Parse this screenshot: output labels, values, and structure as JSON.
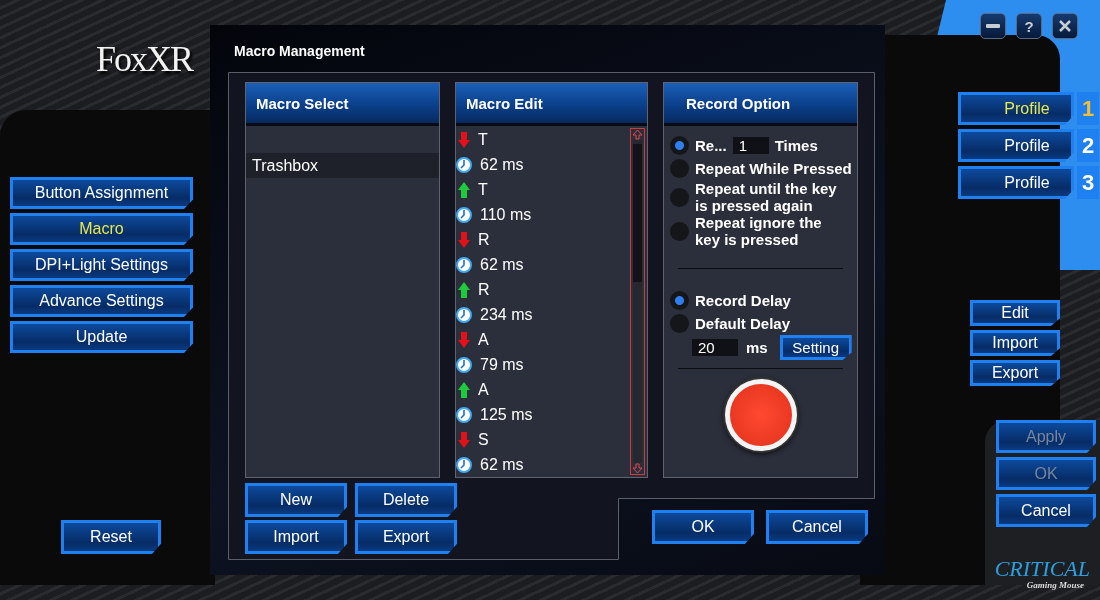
{
  "brand": {
    "logo": "FoxXR"
  },
  "window_controls": [
    {
      "kind": "minimize"
    },
    {
      "kind": "help",
      "label": "?"
    },
    {
      "kind": "close"
    }
  ],
  "sidebar": {
    "items": [
      {
        "label": "Button Assignment",
        "selected": false
      },
      {
        "label": "Macro",
        "selected": true
      },
      {
        "label": "DPI+Light Settings",
        "selected": false
      },
      {
        "label": "Advance Settings",
        "selected": false
      },
      {
        "label": "Update",
        "selected": false
      }
    ],
    "reset": "Reset"
  },
  "profiles": [
    {
      "label": "Profile",
      "number": "1",
      "selected": true
    },
    {
      "label": "Profile",
      "number": "2",
      "selected": false
    },
    {
      "label": "Profile",
      "number": "3",
      "selected": false
    }
  ],
  "profile_actions": [
    "Edit",
    "Import",
    "Export"
  ],
  "main_actions": [
    {
      "label": "Apply",
      "disabled": true
    },
    {
      "label": "OK",
      "disabled": true
    },
    {
      "label": "Cancel",
      "disabled": false
    }
  ],
  "footer_logo": {
    "title": "CRITICAL",
    "subtitle": "Gaming Mouse"
  },
  "dialog": {
    "title": "Macro Management",
    "macro_select": {
      "heading": "Macro Select",
      "items": [
        {
          "label": "Trashbox",
          "selected": true
        }
      ]
    },
    "macro_edit": {
      "heading": "Macro Edit",
      "rows": [
        {
          "kind": "down",
          "text": "T"
        },
        {
          "kind": "delay",
          "text": "62 ms"
        },
        {
          "kind": "up",
          "text": "T"
        },
        {
          "kind": "delay",
          "text": "110 ms"
        },
        {
          "kind": "down",
          "text": "R"
        },
        {
          "kind": "delay",
          "text": "62 ms"
        },
        {
          "kind": "up",
          "text": "R"
        },
        {
          "kind": "delay",
          "text": "234 ms"
        },
        {
          "kind": "down",
          "text": "A"
        },
        {
          "kind": "delay",
          "text": "79 ms"
        },
        {
          "kind": "up",
          "text": "A"
        },
        {
          "kind": "delay",
          "text": "125 ms"
        },
        {
          "kind": "down",
          "text": "S"
        },
        {
          "kind": "delay",
          "text": "62 ms"
        }
      ]
    },
    "record_option": {
      "heading": "Record Option",
      "repeat_options": [
        {
          "kind": "count",
          "label": "Re...",
          "value": "1",
          "suffix": "Times",
          "selected": true
        },
        {
          "kind": "plain",
          "lines": [
            "Repeat While Pressed"
          ],
          "selected": false
        },
        {
          "kind": "plain",
          "lines": [
            "Repeat until the key",
            " is pressed again"
          ],
          "selected": false
        },
        {
          "kind": "plain",
          "lines": [
            "Repeat ignore the",
            "key is pressed"
          ],
          "selected": false
        }
      ],
      "delay_options": [
        {
          "label": "Record Delay",
          "selected": true
        },
        {
          "label": "Default Delay",
          "selected": false
        }
      ],
      "default_delay": {
        "value": "20",
        "unit": "ms",
        "button": "Setting"
      }
    },
    "list_buttons": [
      "New",
      "Delete",
      "Import",
      "Export"
    ],
    "buttons": [
      "OK",
      "Cancel"
    ]
  }
}
